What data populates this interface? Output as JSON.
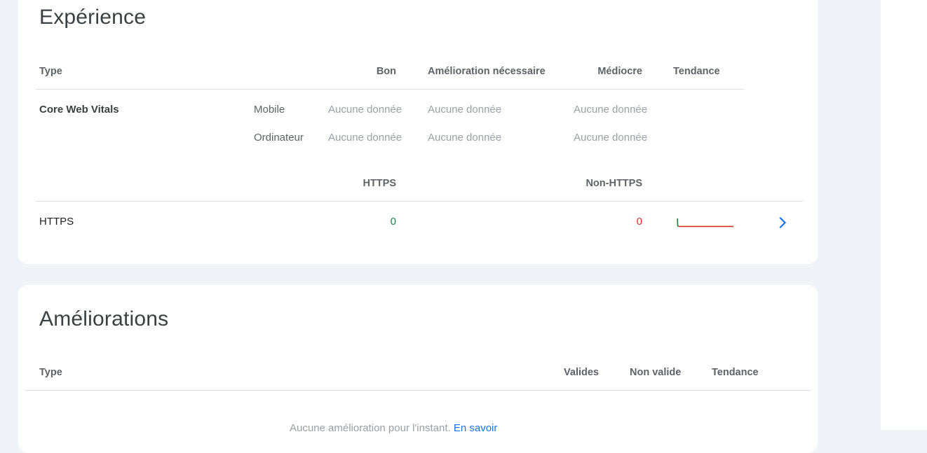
{
  "experience": {
    "title": "Expérience",
    "headers": {
      "type": "Type",
      "good": "Bon",
      "needs_improvement": "Amélioration nécessaire",
      "poor": "Médiocre",
      "trend": "Tendance"
    },
    "cwv": {
      "label": "Core Web Vitals",
      "rows": [
        {
          "device": "Mobile",
          "good": "Aucune donnée",
          "needs_improvement": "Aucune donnée",
          "poor": "Aucune donnée"
        },
        {
          "device": "Ordinateur",
          "good": "Aucune donnée",
          "needs_improvement": "Aucune donnée",
          "poor": "Aucune donnée"
        }
      ]
    },
    "https_headers": {
      "https": "HTTPS",
      "non_https": "Non-HTTPS"
    },
    "https_row": {
      "label": "HTTPS",
      "https_count": "0",
      "non_https_count": "0"
    },
    "icons": {
      "trend": "trend-sparkline-icon",
      "open": "chevron-right-icon"
    },
    "colors": {
      "good": "#188038",
      "bad": "#d93025",
      "link": "#1a73e8"
    }
  },
  "enhancements": {
    "title": "Améliorations",
    "headers": {
      "type": "Type",
      "valid": "Valides",
      "invalid": "Non valide",
      "trend": "Tendance"
    },
    "empty_text": "Aucune amélioration pour l'instant.",
    "learn_more": "En savoir"
  }
}
